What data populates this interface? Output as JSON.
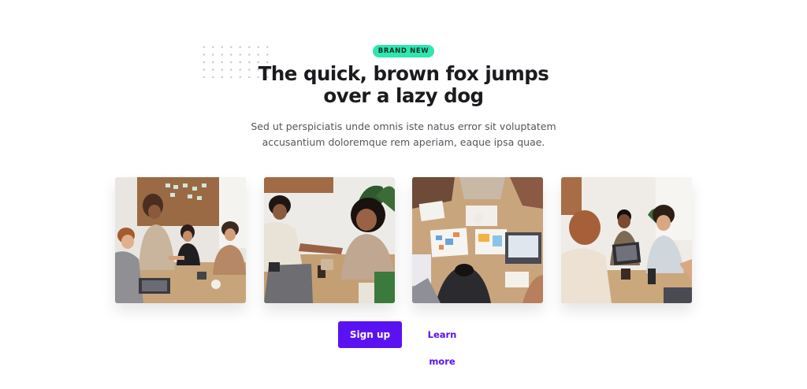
{
  "hero": {
    "badge": "BRAND NEW",
    "headline_line1": "The quick, brown fox jumps",
    "headline_line2": "over a lazy dog",
    "subtext_line1": "Sed ut perspiciatis unde omnis iste natus error sit voluptatem",
    "subtext_line2": "accusantium doloremque rem aperiam, eaque ipsa quae."
  },
  "gallery": {
    "photos": [
      {
        "subject": "team meeting handshake at table"
      },
      {
        "subject": "two colleagues shaking hands"
      },
      {
        "subject": "overhead view of charts on desk"
      },
      {
        "subject": "group discussion with laptops"
      }
    ]
  },
  "actions": {
    "primary_label": "Sign up",
    "secondary_label": "Learn more"
  },
  "colors": {
    "accent": "#5b12f2",
    "badge": "#2ee6b0",
    "heading": "#1b1b1f",
    "body_text": "#55555c"
  }
}
